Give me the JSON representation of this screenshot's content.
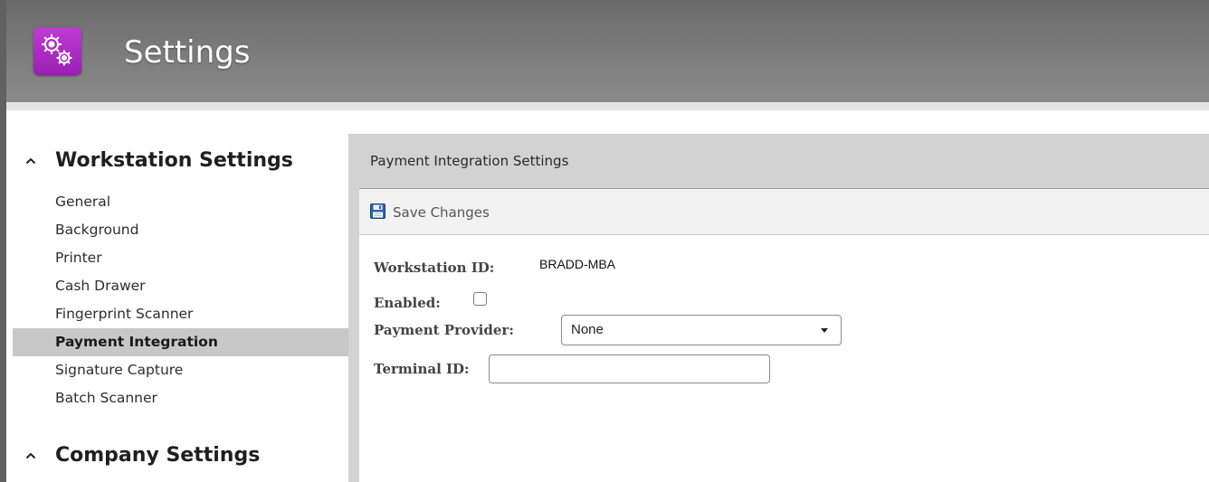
{
  "app": {
    "title": "Settings",
    "icon": "gears-icon",
    "icon_color": "#b22fca"
  },
  "sidebar": {
    "sections": [
      {
        "title": "Workstation Settings",
        "expanded": true,
        "items": [
          {
            "label": "General",
            "active": false
          },
          {
            "label": "Background",
            "active": false
          },
          {
            "label": "Printer",
            "active": false
          },
          {
            "label": "Cash Drawer",
            "active": false
          },
          {
            "label": "Fingerprint Scanner",
            "active": false
          },
          {
            "label": "Payment Integration",
            "active": true
          },
          {
            "label": "Signature Capture",
            "active": false
          },
          {
            "label": "Batch Scanner",
            "active": false
          }
        ]
      },
      {
        "title": "Company Settings",
        "expanded": true,
        "items": []
      }
    ]
  },
  "panel": {
    "title": "Payment Integration Settings",
    "toolbar": {
      "save_label": "Save Changes",
      "save_icon": "save-icon"
    },
    "form": {
      "workstation_id_label": "Workstation ID:",
      "workstation_id_value": "BRADD-MBA",
      "enabled_label": "Enabled:",
      "enabled_checked": false,
      "payment_provider_label": "Payment Provider:",
      "payment_provider_value": "None",
      "terminal_id_label": "Terminal ID:",
      "terminal_id_value": ""
    }
  },
  "colors": {
    "header_bg": "#777777",
    "active_item_bg": "#c8c8c8",
    "panel_header_bg": "#d2d2d2",
    "toolbar_bg": "#f2f2f2"
  }
}
